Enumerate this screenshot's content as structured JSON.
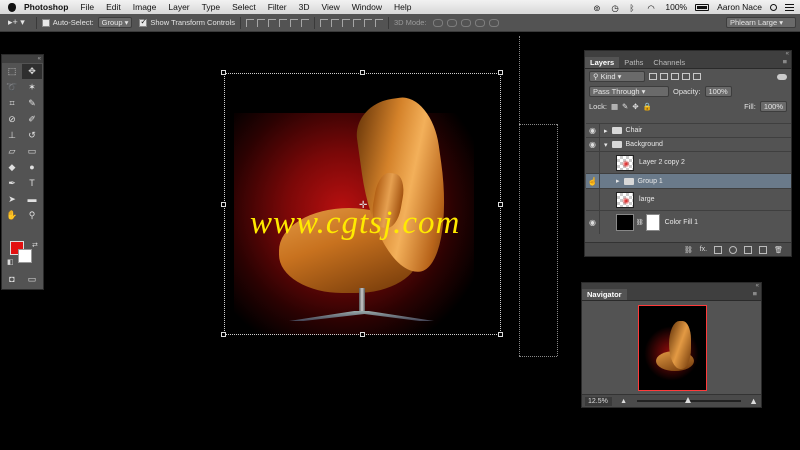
{
  "menubar": {
    "app": "Photoshop",
    "items": [
      "File",
      "Edit",
      "Image",
      "Layer",
      "Type",
      "Select",
      "Filter",
      "3D",
      "View",
      "Window",
      "Help"
    ],
    "battery": "100%",
    "user": "Aaron Nace"
  },
  "options": {
    "auto_select_label": "Auto-Select:",
    "auto_select_value": "Group",
    "show_transform_label": "Show Transform Controls",
    "mode_label": "3D Mode:",
    "workspace": "Phlearn Large"
  },
  "watermark": "www.cgtsj.com",
  "layers_panel": {
    "tabs": [
      "Layers",
      "Paths",
      "Channels"
    ],
    "filter_kind": "Kind",
    "blend_mode": "Pass Through",
    "opacity_label": "Opacity:",
    "opacity_value": "100%",
    "lock_label": "Lock:",
    "fill_label": "Fill:",
    "fill_value": "100%",
    "layers": [
      {
        "name": "Chair",
        "type": "group"
      },
      {
        "name": "Background",
        "type": "group"
      },
      {
        "name": "Layer 2 copy 2",
        "type": "layer"
      },
      {
        "name": "Group 1",
        "type": "group"
      },
      {
        "name": "large",
        "type": "layer"
      },
      {
        "name": "Color Fill 1",
        "type": "fill"
      }
    ],
    "footer_icons": [
      "link-icon",
      "fx-icon",
      "mask-icon",
      "adjustment-icon",
      "new-group-icon",
      "new-layer-icon",
      "trash-icon"
    ]
  },
  "navigator": {
    "title": "Navigator",
    "zoom": "12.5%"
  },
  "colors": {
    "foreground": "#e21010",
    "background": "#ffffff",
    "watermark": "#ffea00"
  }
}
